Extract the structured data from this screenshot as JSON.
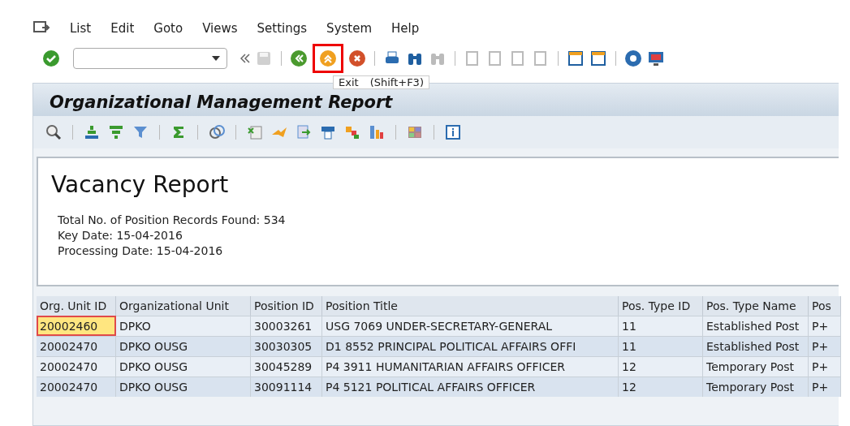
{
  "menu": [
    "List",
    "Edit",
    "Goto",
    "Views",
    "Settings",
    "System",
    "Help"
  ],
  "exit_button": {
    "highlighted": true,
    "tooltip": "Exit",
    "shortcut": "(Shift+F3)"
  },
  "title": "Organizational Management Report",
  "report": {
    "heading": "Vacancy Report",
    "lines": [
      "Total No. of Position Records Found: 534",
      "Key Date: 15-04-2016",
      "Processing Date: 15-04-2016"
    ]
  },
  "table": {
    "columns": [
      "Org. Unit ID",
      "Organizational Unit",
      "Position ID",
      "Position Title",
      "Pos. Type ID",
      "Pos. Type Name",
      "Pos"
    ],
    "rows": [
      {
        "cursor": true,
        "cells": [
          "20002460",
          "DPKO",
          "30003261",
          "USG 7069 UNDER-SECRETARY-GENERAL",
          "11",
          "Established Post",
          "P+"
        ]
      },
      {
        "cursor": false,
        "cells": [
          "20002470",
          "DPKO OUSG",
          "30030305",
          "D1 8552 PRINCIPAL POLITICAL AFFAIRS OFFI",
          "11",
          "Established Post",
          "P+"
        ]
      },
      {
        "cursor": false,
        "cells": [
          "20002470",
          "DPKO OUSG",
          "30045289",
          "P4 3911 HUMANITARIAN AFFAIRS OFFICER",
          "12",
          "Temporary Post",
          "P+"
        ]
      },
      {
        "cursor": false,
        "cells": [
          "20002470",
          "DPKO OUSG",
          "30091114",
          "P4 5121 POLITICAL AFFAIRS OFFICER",
          "12",
          "Temporary Post",
          "P+"
        ]
      }
    ]
  }
}
